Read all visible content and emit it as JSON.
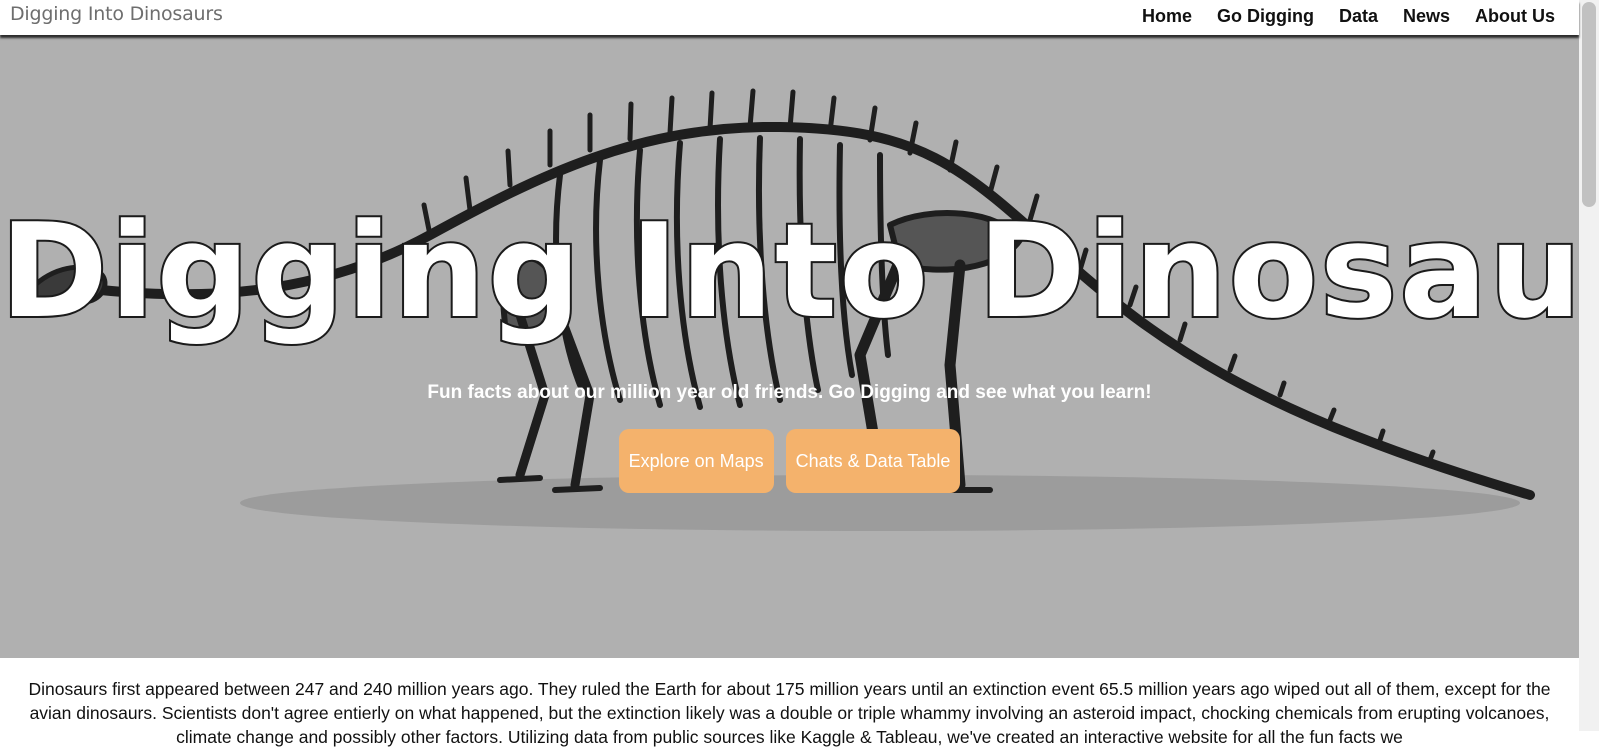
{
  "navbar": {
    "brand": "Digging Into Dinosaurs",
    "links": [
      "Home",
      "Go Digging",
      "Data",
      "News",
      "About Us"
    ]
  },
  "hero": {
    "title": "Digging Into Dinosaurs",
    "subtitle": "Fun facts about our million year old friends. Go Digging and see what you learn!",
    "buttons": [
      "Explore on Maps",
      "Chats & Data Table"
    ],
    "background_color": "#b0b0b0",
    "button_color": "#f4b26c",
    "illustration": "dinosaur-skeleton"
  },
  "intro": {
    "text": "Dinosaurs first appeared between 247 and 240 million years ago. They ruled the Earth for about 175 million years until an extinction event 65.5 million years ago wiped out all of them, except for the avian dinosaurs. Scientists don't agree entierly on what happened, but the extinction likely was a double or triple whammy involving an asteroid impact, chocking chemicals from erupting volcanoes, climate change and possibly other factors. Utilizing data from public sources like Kaggle & Tableau, we've created an interactive website for all the fun facts we"
  }
}
